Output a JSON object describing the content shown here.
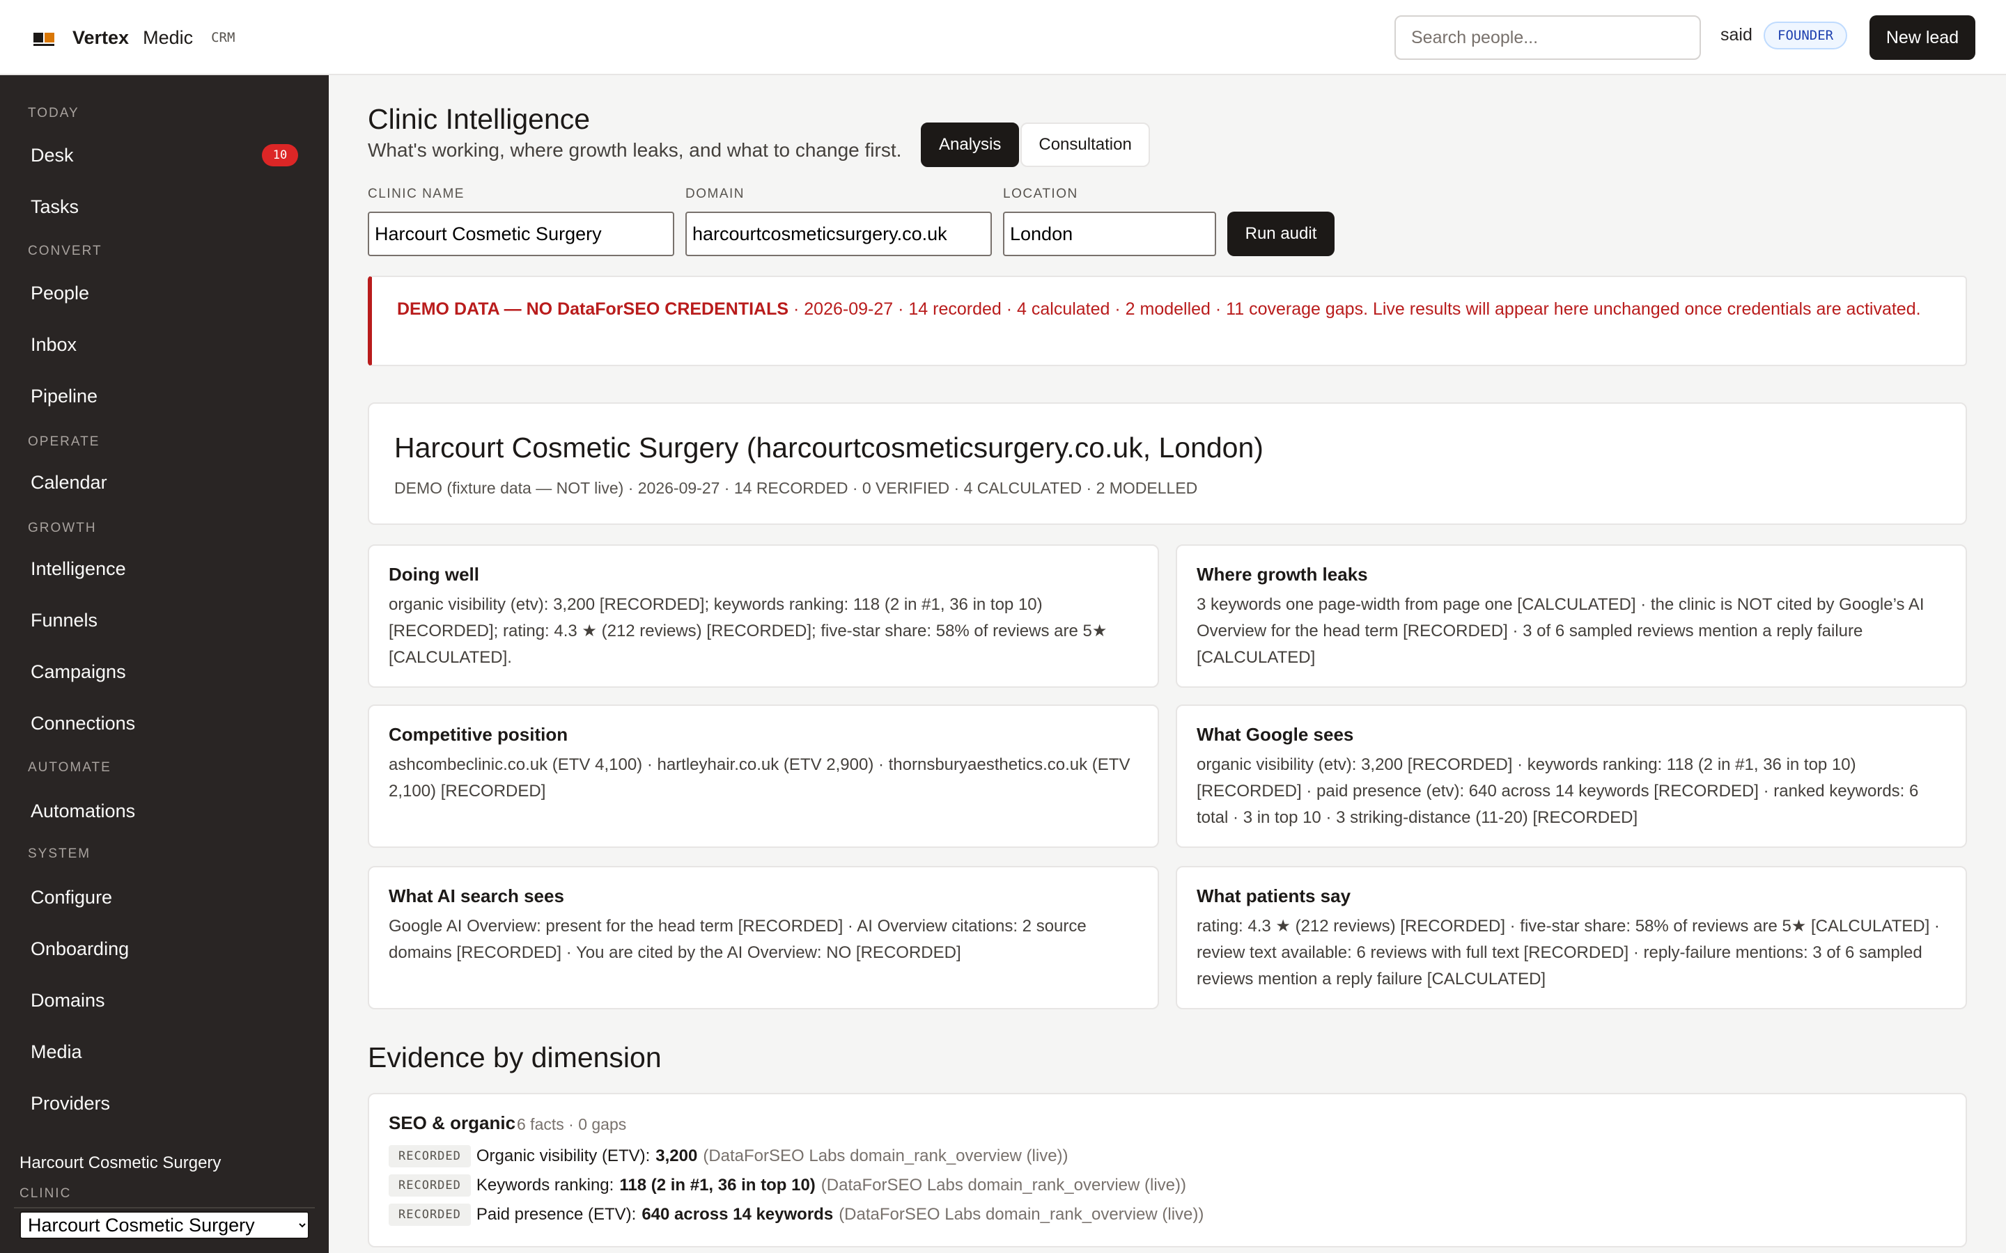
{
  "brand": {
    "name": "Vertex",
    "product": "Medic",
    "crm": "CRM"
  },
  "header": {
    "search_placeholder": "Search people...",
    "user": "said",
    "role": "FOUNDER",
    "new_lead": "New lead"
  },
  "sidebar": {
    "sections": [
      "TODAY",
      "CONVERT",
      "OPERATE",
      "GROWTH",
      "AUTOMATE",
      "SYSTEM"
    ],
    "items": [
      {
        "label": "Desk",
        "badge": "10"
      },
      {
        "label": "Tasks"
      },
      {
        "label": "People"
      },
      {
        "label": "Inbox"
      },
      {
        "label": "Pipeline"
      },
      {
        "label": "Calendar"
      },
      {
        "label": "Intelligence"
      },
      {
        "label": "Funnels"
      },
      {
        "label": "Campaigns"
      },
      {
        "label": "Connections"
      },
      {
        "label": "Automations"
      },
      {
        "label": "Configure"
      },
      {
        "label": "Onboarding"
      },
      {
        "label": "Domains"
      },
      {
        "label": "Media"
      },
      {
        "label": "Providers"
      }
    ],
    "clinic_name": "Harcourt Cosmetic Surgery",
    "clinic_label": "CLINIC",
    "clinic_select": "Harcourt Cosmetic Surgery"
  },
  "page": {
    "title": "Clinic Intelligence",
    "subtitle": "What's working, where growth leaks, and what to change first.",
    "tabs": [
      {
        "label": "Analysis"
      },
      {
        "label": "Consultation"
      }
    ]
  },
  "form": {
    "clinic_label": "CLINIC NAME",
    "clinic_value": "Harcourt Cosmetic Surgery",
    "domain_label": "DOMAIN",
    "domain_value": "harcourtcosmeticsurgery.co.uk",
    "location_label": "LOCATION",
    "location_value": "London",
    "run": "Run audit"
  },
  "banner": {
    "strong": "DEMO DATA — NO DataForSEO CREDENTIALS",
    "rest": " · 2026-09-27 · 14 recorded · 4 calculated · 2 modelled · 11 coverage gaps. Live results will appear here unchanged once credentials are activated."
  },
  "summary": {
    "title": "Harcourt Cosmetic Surgery (harcourtcosmeticsurgery.co.uk, London)",
    "meta": "DEMO (fixture data — NOT live) · 2026-09-27 · 14 RECORDED · 0 VERIFIED · 4 CALCULATED · 2 MODELLED"
  },
  "cards": [
    {
      "title": "Doing well",
      "body": "organic visibility (etv): 3,200 [RECORDED]; keywords ranking: 118 (2 in #1, 36 in top 10) [RECORDED]; rating: 4.3 ★ (212 reviews) [RECORDED]; five-star share: 58% of reviews are 5★ [CALCULATED]."
    },
    {
      "title": "Where growth leaks",
      "body": "3 keywords one page-width from page one [CALCULATED] · the clinic is NOT cited by Google’s AI Overview for the head term [RECORDED] · 3 of 6 sampled reviews mention a reply failure [CALCULATED]"
    },
    {
      "title": "Competitive position",
      "body": "ashcombeclinic.co.uk (ETV 4,100) · hartleyhair.co.uk (ETV 2,900) · thornsburyaesthetics.co.uk (ETV 2,100) [RECORDED]"
    },
    {
      "title": "What Google sees",
      "body": "organic visibility (etv): 3,200 [RECORDED] · keywords ranking: 118 (2 in #1, 36 in top 10) [RECORDED] · paid presence (etv): 640 across 14 keywords [RECORDED] · ranked keywords: 6 total · 3 in top 10 · 3 striking-distance (11-20) [RECORDED]"
    },
    {
      "title": "What AI search sees",
      "body": "Google AI Overview: present for the head term [RECORDED] · AI Overview citations: 2 source domains [RECORDED] · You are cited by the AI Overview: NO [RECORDED]"
    },
    {
      "title": "What patients say",
      "body": "rating: 4.3 ★ (212 reviews) [RECORDED] · five-star share: 58% of reviews are 5★ [CALCULATED] · review text available: 6 reviews with full text [RECORDED] · reply-failure mentions: 3 of 6 sampled reviews mention a reply failure [CALCULATED]"
    }
  ],
  "evidence": {
    "title": "Evidence by dimension",
    "dimension": "SEO & organic",
    "meta": "6 facts · 0 gaps",
    "facts": [
      {
        "tag": "RECORDED",
        "label": "Organic visibility (ETV):",
        "value": "3,200",
        "source": "(DataForSEO Labs domain_rank_overview (live))"
      },
      {
        "tag": "RECORDED",
        "label": "Keywords ranking:",
        "value": "118 (2 in #1, 36 in top 10)",
        "source": "(DataForSEO Labs domain_rank_overview (live))"
      },
      {
        "tag": "RECORDED",
        "label": "Paid presence (ETV):",
        "value": "640 across 14 keywords",
        "source": "(DataForSEO Labs domain_rank_overview (live))"
      }
    ]
  },
  "colors": {
    "sidebar_bg": "#292524",
    "accent_dark": "#1c1917",
    "alert_red": "#b91c1c",
    "badge_red": "#dc2626"
  },
  "icons": {
    "brand": "vertex-logo-icon"
  }
}
